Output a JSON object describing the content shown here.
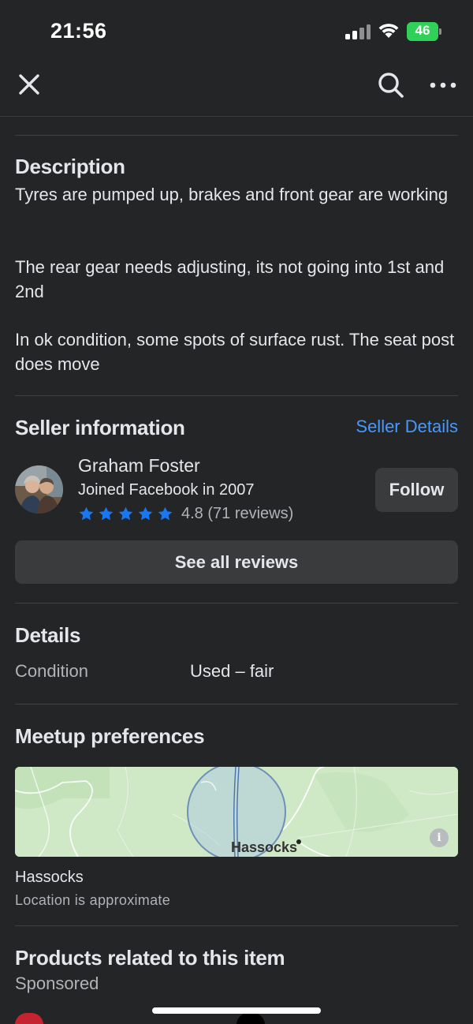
{
  "status_bar": {
    "time": "21:56",
    "battery": "46"
  },
  "description": {
    "heading": "Description",
    "paragraphs": [
      "Tyres are pumped up, brakes and front gear are working",
      "The rear gear needs adjusting, its not going into 1st and 2nd",
      "In ok condition, some spots of surface rust. The seat post does move"
    ]
  },
  "seller": {
    "heading": "Seller information",
    "details_link": "Seller Details",
    "name": "Graham Foster",
    "joined": "Joined Facebook in 2007",
    "rating_stars": 5,
    "rating_text": "4.8 (71 reviews)",
    "follow_label": "Follow",
    "see_reviews_label": "See all reviews"
  },
  "details": {
    "heading": "Details",
    "rows": [
      {
        "label": "Condition",
        "value": "Used – fair"
      }
    ]
  },
  "meetup": {
    "heading": "Meetup preferences",
    "map_label": "Hassocks",
    "location": "Hassocks",
    "location_note": "Location is approximate"
  },
  "related": {
    "heading": "Products related to this item",
    "sponsored_label": "Sponsored"
  },
  "colors": {
    "background": "#242526",
    "link": "#4599ff",
    "star": "#1877f2",
    "button": "#3a3b3c",
    "battery": "#30d158"
  }
}
